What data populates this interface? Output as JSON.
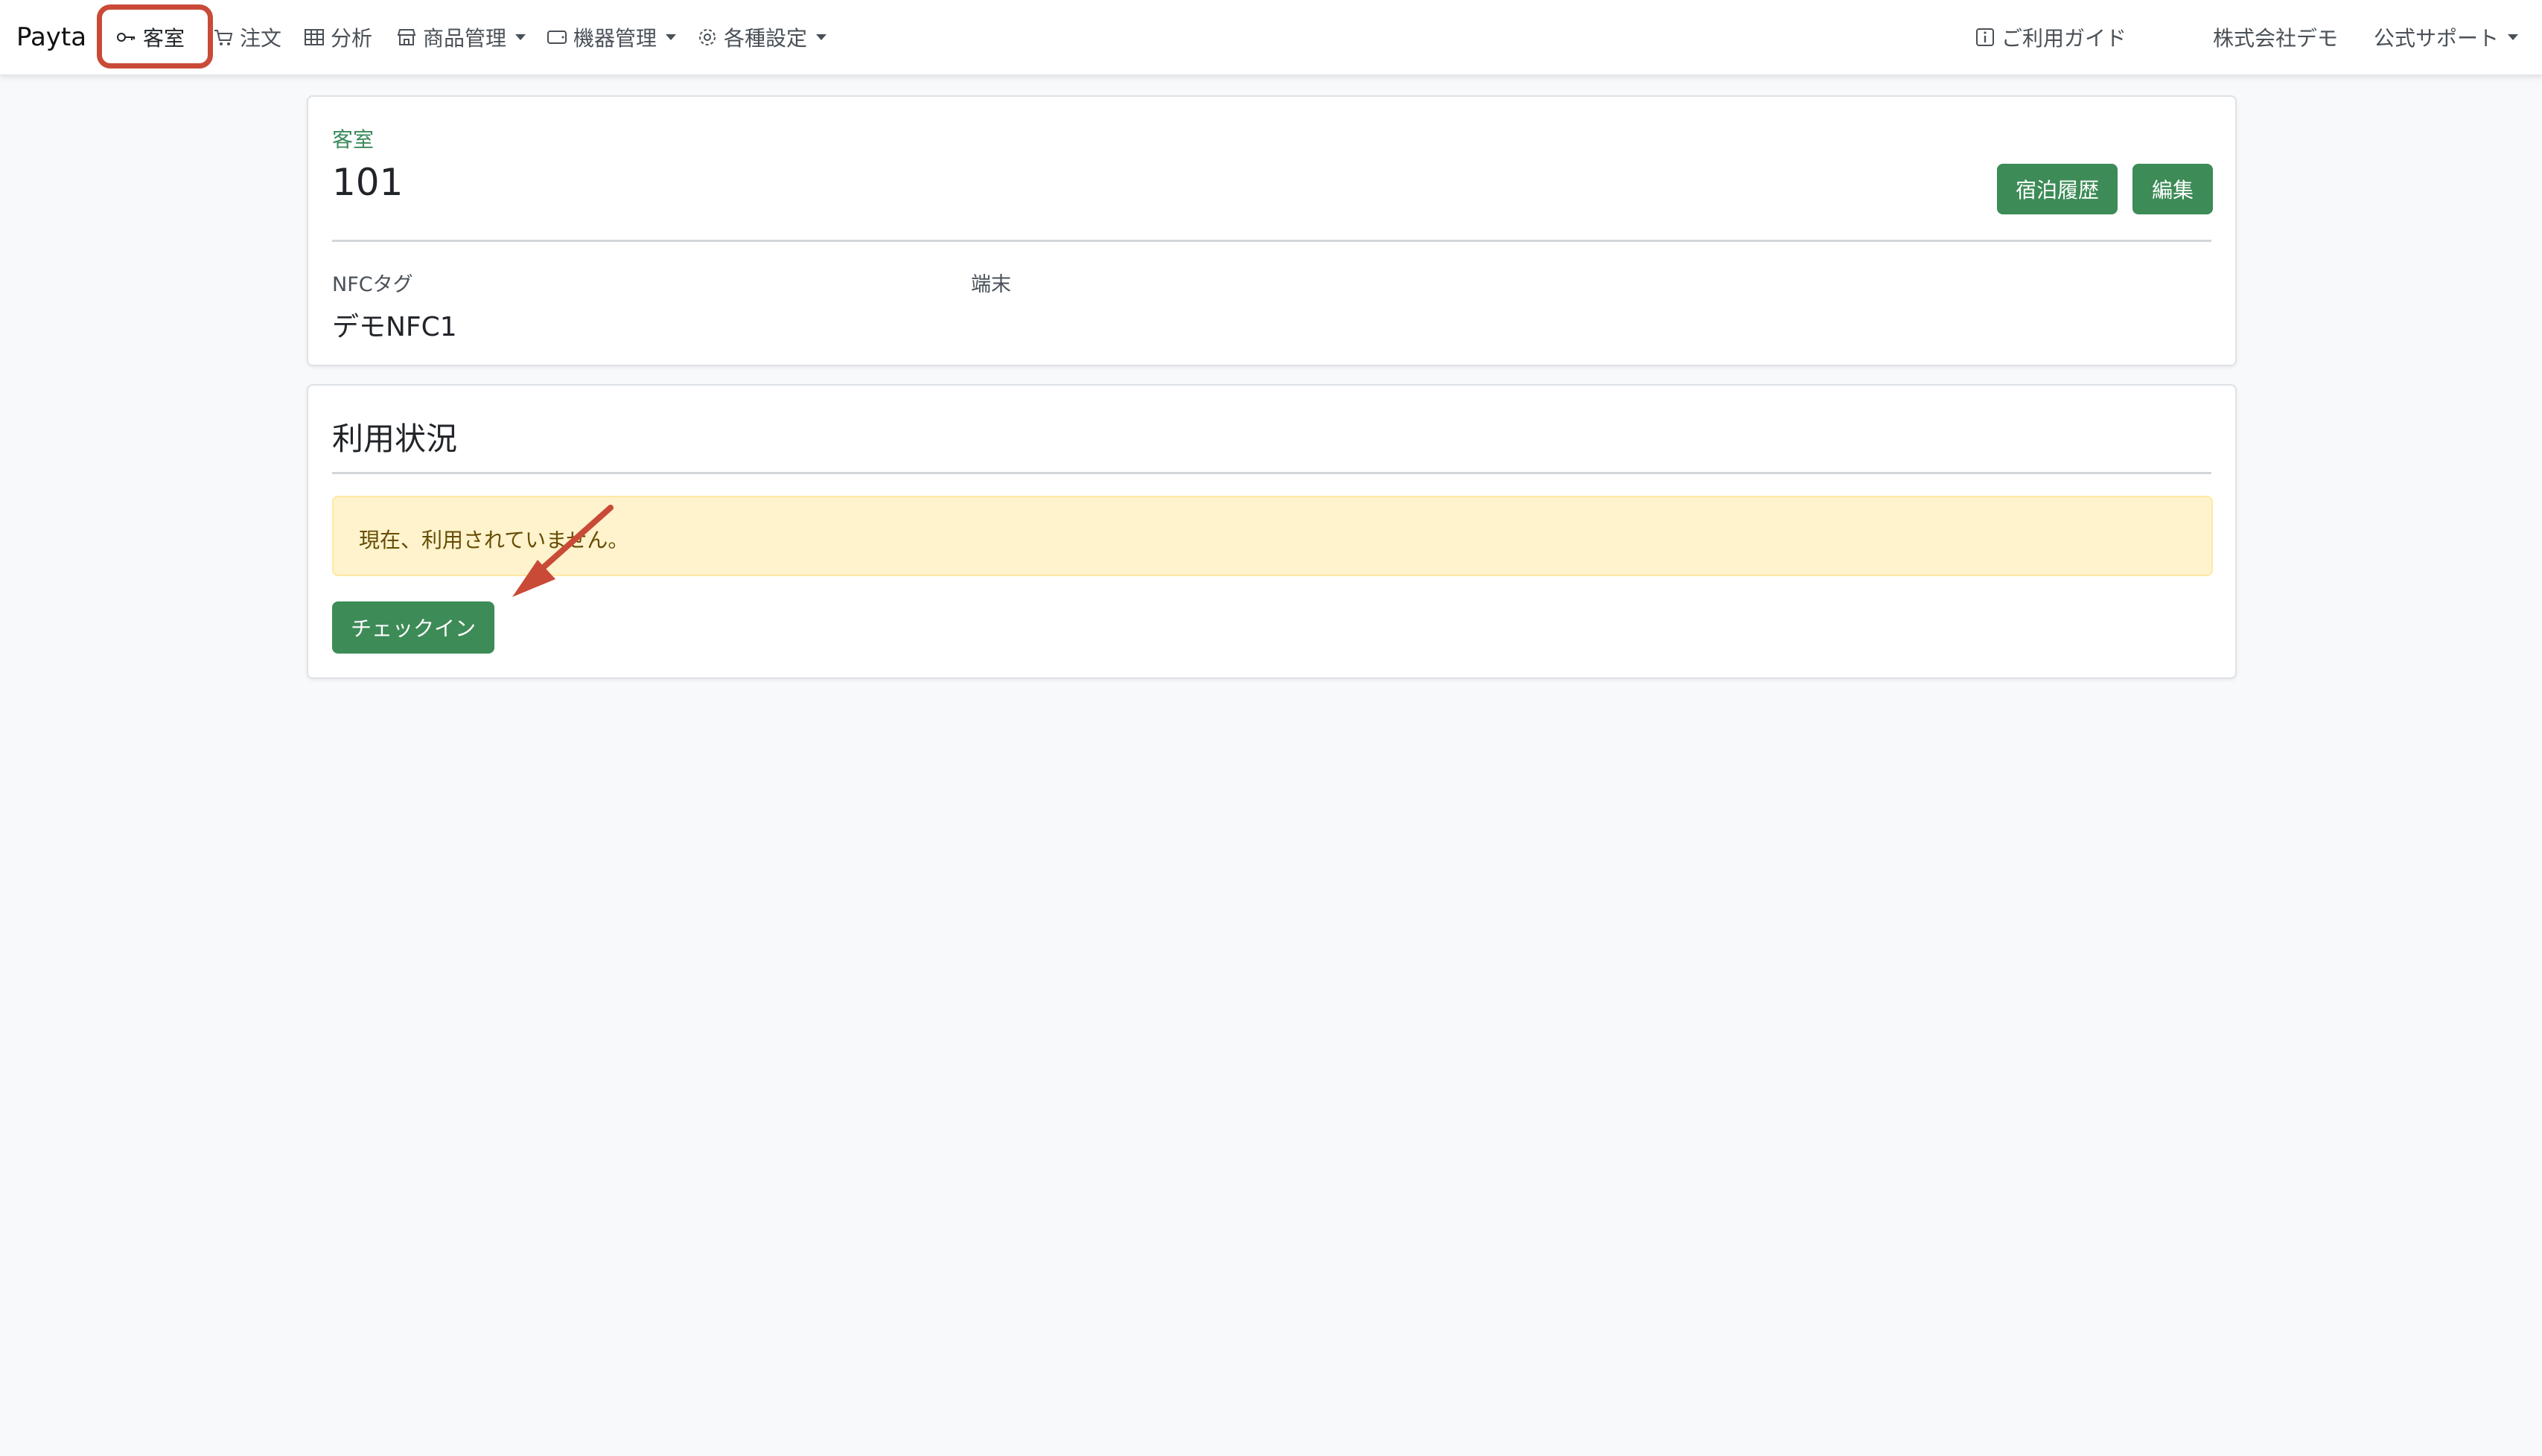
{
  "navbar": {
    "brand": "Payta",
    "items": [
      {
        "label": "客室",
        "icon": "key-icon"
      },
      {
        "label": "注文",
        "icon": "cart-icon"
      },
      {
        "label": "分析",
        "icon": "table-icon"
      },
      {
        "label": "商品管理",
        "icon": "shop-icon"
      },
      {
        "label": "機器管理",
        "icon": "tablet-icon"
      },
      {
        "label": "各種設定",
        "icon": "gear-icon"
      }
    ],
    "right": {
      "guide": "ご利用ガイド",
      "company": "株式会社デモ",
      "support": "公式サポート"
    }
  },
  "room_card": {
    "caption": "客室",
    "number": "101",
    "history_button": "宿泊履歴",
    "edit_button": "編集",
    "nfc_label": "NFCタグ",
    "nfc_value": "デモNFC1",
    "terminal_label": "端末"
  },
  "status_card": {
    "title": "利用状況",
    "alert_text": "現在、利用されていません。",
    "checkin_button": "チェックイン"
  },
  "colors": {
    "accent_green": "#3d8b57",
    "annotation_red": "#c94a37",
    "alert_bg": "#fff3cd"
  }
}
